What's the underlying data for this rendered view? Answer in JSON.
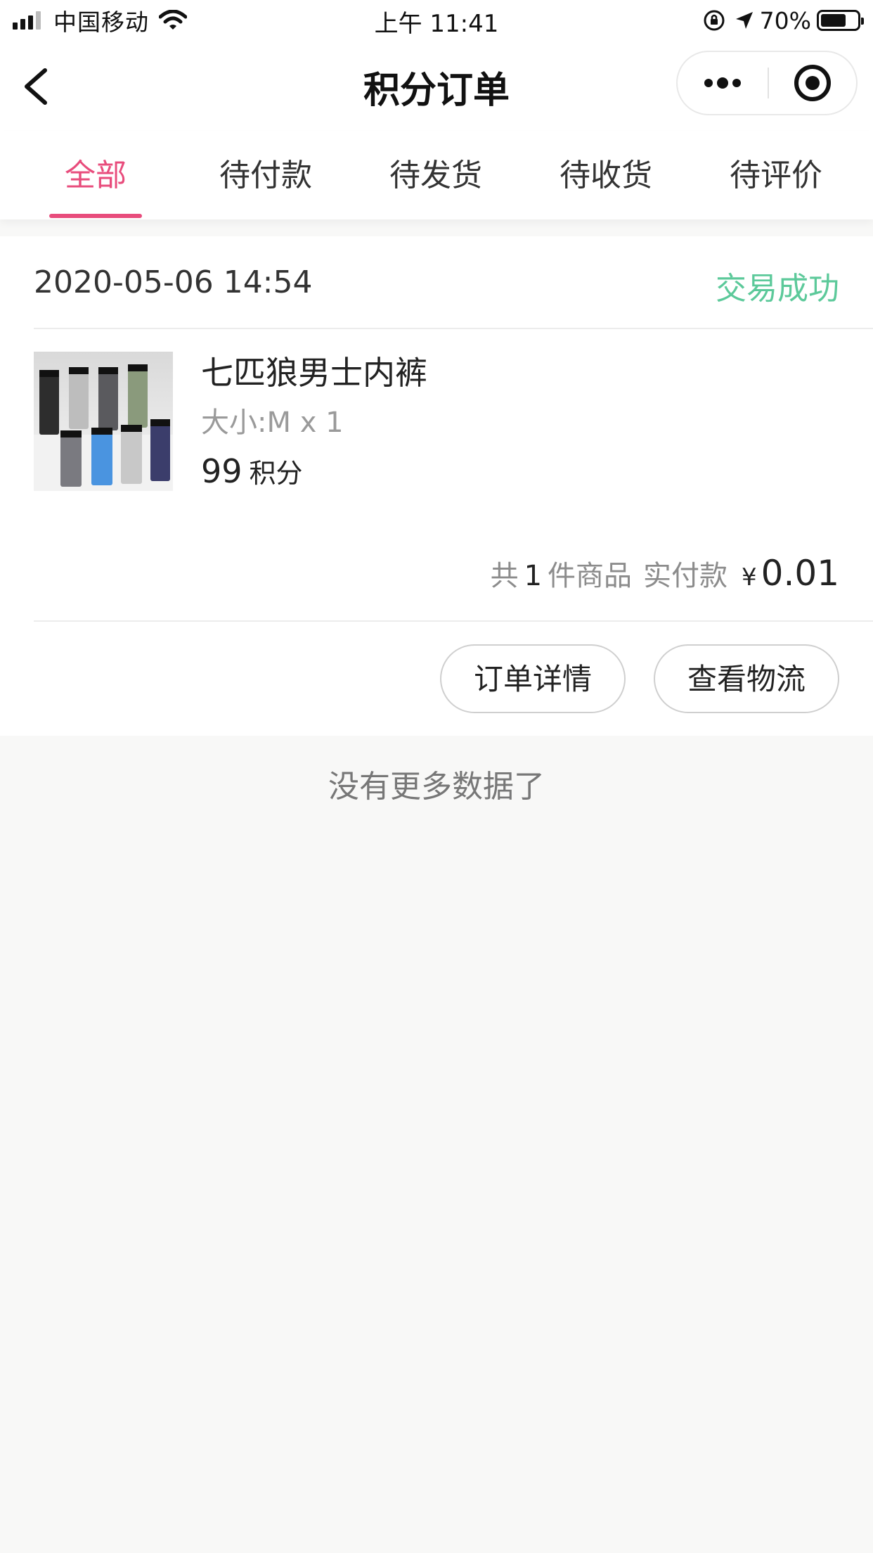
{
  "status_bar": {
    "carrier": "中国移动",
    "time": "上午 11:41",
    "battery_percent": "70%",
    "battery_level": 0.7,
    "icons": [
      "signal-icon",
      "wifi-icon",
      "rotation-lock-icon",
      "location-icon",
      "battery-icon"
    ]
  },
  "nav": {
    "title": "积分订单",
    "icons": [
      "back-icon",
      "more-icon",
      "close-mini-program-icon"
    ]
  },
  "tabs": [
    {
      "label": "全部",
      "active": true
    },
    {
      "label": "待付款",
      "active": false
    },
    {
      "label": "待发货",
      "active": false
    },
    {
      "label": "待收货",
      "active": false
    },
    {
      "label": "待评价",
      "active": false
    }
  ],
  "colors": {
    "accent": "#e84c7c",
    "success": "#5cc99a",
    "background": "#f8f8f7"
  },
  "order": {
    "time": "2020-05-06 14:54",
    "status": "交易成功",
    "product": {
      "name": "七匹狼男士内裤",
      "spec": "大小:M x 1",
      "points": "99",
      "points_unit": "积分"
    },
    "summary": {
      "prefix": "共",
      "count": "1",
      "count_suffix": "件商品",
      "paid_label": "实付款",
      "currency": "¥",
      "amount": "0.01"
    },
    "buttons": {
      "detail": "订单详情",
      "logistics": "查看物流"
    }
  },
  "footer": {
    "no_more": "没有更多数据了"
  }
}
